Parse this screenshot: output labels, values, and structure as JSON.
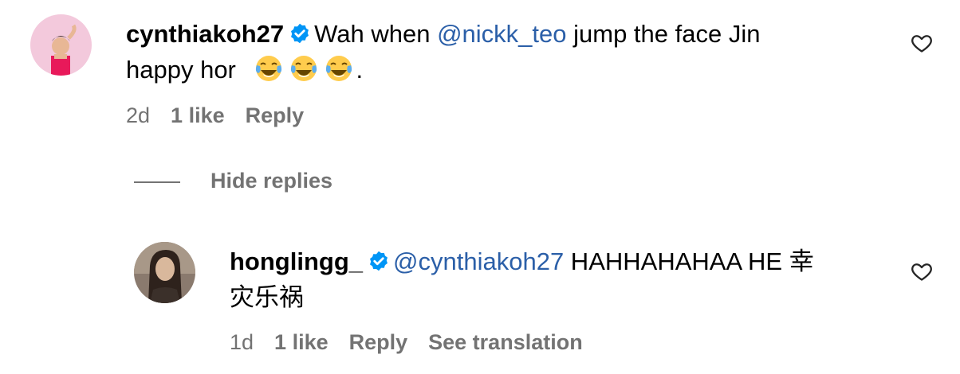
{
  "comment": {
    "username": "cynthiakoh27",
    "text_part1": "Wah when ",
    "mention": "@nickk_teo",
    "text_part2": " jump the face Jin",
    "text_line2": "happy hor",
    "text_end": ".",
    "time": "2d",
    "likes": "1 like",
    "reply_label": "Reply"
  },
  "hide_replies_label": "Hide replies",
  "reply": {
    "username": "honglingg_",
    "mention": "@cynthiakoh27",
    "text_part1": " HAHHAHAHAA HE 幸",
    "text_line2": "灾乐祸",
    "time": "1d",
    "likes": "1 like",
    "reply_label": "Reply",
    "translate_label": "See translation"
  },
  "colors": {
    "mention": "#2b5fa8",
    "verified": "#0095f6",
    "meta": "#737373"
  },
  "icons": {
    "verified": "verified-badge-icon",
    "heart": "heart-outline-icon",
    "emoji": "face-with-tears-of-joy-emoji"
  }
}
